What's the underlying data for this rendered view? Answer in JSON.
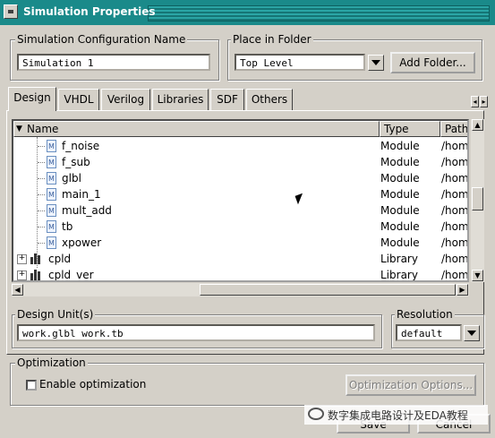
{
  "window": {
    "title": "Simulation Properties"
  },
  "config_name": {
    "label": "Simulation Configuration Name",
    "value": "Simulation 1"
  },
  "folder": {
    "label": "Place in Folder",
    "value": "Top Level",
    "add_button": "Add Folder..."
  },
  "tabs": [
    "Design",
    "VHDL",
    "Verilog",
    "Libraries",
    "SDF",
    "Others"
  ],
  "active_tab": "Design",
  "tree": {
    "columns": [
      "Name",
      "Type",
      "Path"
    ],
    "rows": [
      {
        "name": "f_noise",
        "type": "Module",
        "path": "/home",
        "icon": "module-icon"
      },
      {
        "name": "f_sub",
        "type": "Module",
        "path": "/home",
        "icon": "module-icon"
      },
      {
        "name": "glbl",
        "type": "Module",
        "path": "/home",
        "icon": "module-icon"
      },
      {
        "name": "main_1",
        "type": "Module",
        "path": "/home",
        "icon": "module-icon"
      },
      {
        "name": "mult_add",
        "type": "Module",
        "path": "/home",
        "icon": "module-icon"
      },
      {
        "name": "tb",
        "type": "Module",
        "path": "/home",
        "icon": "module-icon"
      },
      {
        "name": "xpower",
        "type": "Module",
        "path": "/home",
        "icon": "module-icon"
      },
      {
        "name": "cpld",
        "type": "Library",
        "path": "/home",
        "icon": "library-icon"
      },
      {
        "name": "cpld_ver",
        "type": "Library",
        "path": "/home",
        "icon": "library-icon"
      }
    ]
  },
  "design_units": {
    "label": "Design Unit(s)",
    "value": "work.glbl work.tb"
  },
  "resolution": {
    "label": "Resolution",
    "value": "default"
  },
  "optimization": {
    "label": "Optimization",
    "checkbox_label": "Enable optimization",
    "checked": false,
    "options_button": "Optimization Options..."
  },
  "footer": {
    "save": "Save",
    "cancel": "Cancel"
  },
  "watermark": "数字集成电路设计及EDA教程"
}
